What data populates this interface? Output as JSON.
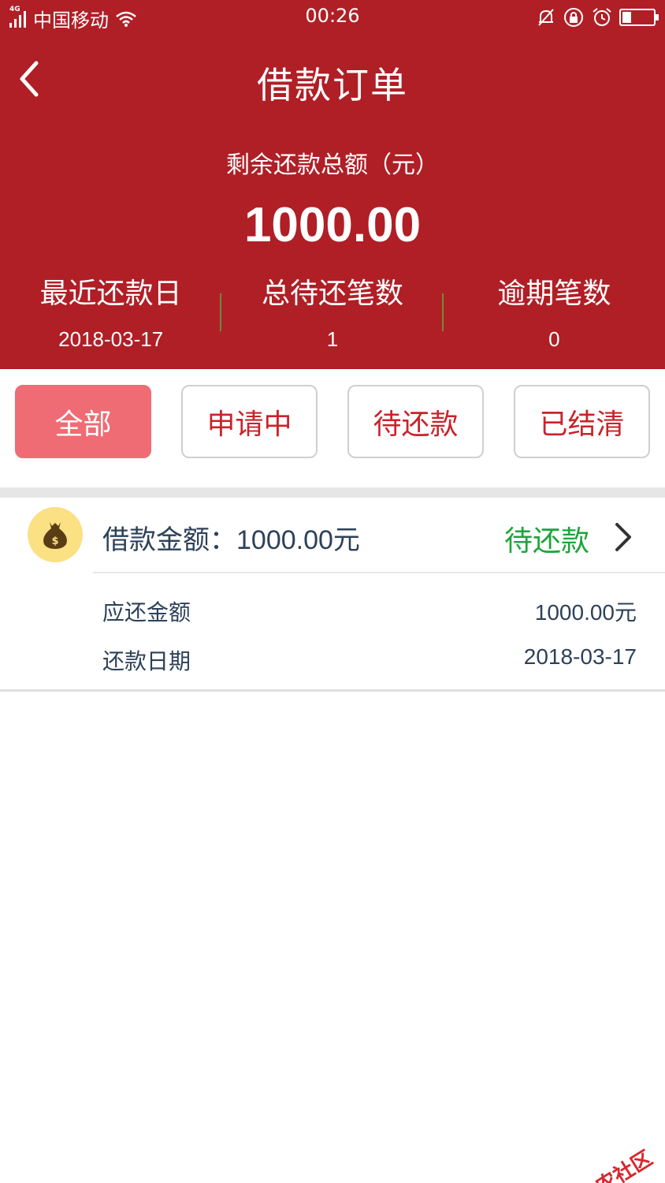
{
  "status_bar": {
    "network": "4G",
    "carrier": "中国移动",
    "time": "00:26",
    "battery_level": 0.3
  },
  "nav": {
    "title": "借款订单",
    "back_icon": "chevron-left-icon"
  },
  "summary": {
    "total_label": "剩余还款总额（元）",
    "total_amount": "1000.00",
    "stats": [
      {
        "label": "最近还款日",
        "value": "2018-03-17"
      },
      {
        "label": "总待还笔数",
        "value": "1"
      },
      {
        "label": "逾期笔数",
        "value": "0"
      }
    ]
  },
  "filters": [
    {
      "label": "全部",
      "active": true
    },
    {
      "label": "申请中",
      "active": false
    },
    {
      "label": "待还款",
      "active": false
    },
    {
      "label": "已结清",
      "active": false
    }
  ],
  "order": {
    "icon": "money-bag-icon",
    "amount_label": "借款金额：",
    "amount_value": "1000.00元",
    "status": "待还款",
    "rows": [
      {
        "key": "应还金额",
        "value": "1000.00元"
      },
      {
        "key": "还款日期",
        "value": "2018-03-17"
      }
    ]
  },
  "watermark": {
    "text": "卡农社区"
  },
  "colors": {
    "header_bg": "#b01f26",
    "filter_active_bg": "#ef6c74",
    "filter_text": "#c9232b",
    "status_green": "#1fa43a",
    "text_navy": "#2d4159",
    "icon_bg": "#fbe084"
  }
}
